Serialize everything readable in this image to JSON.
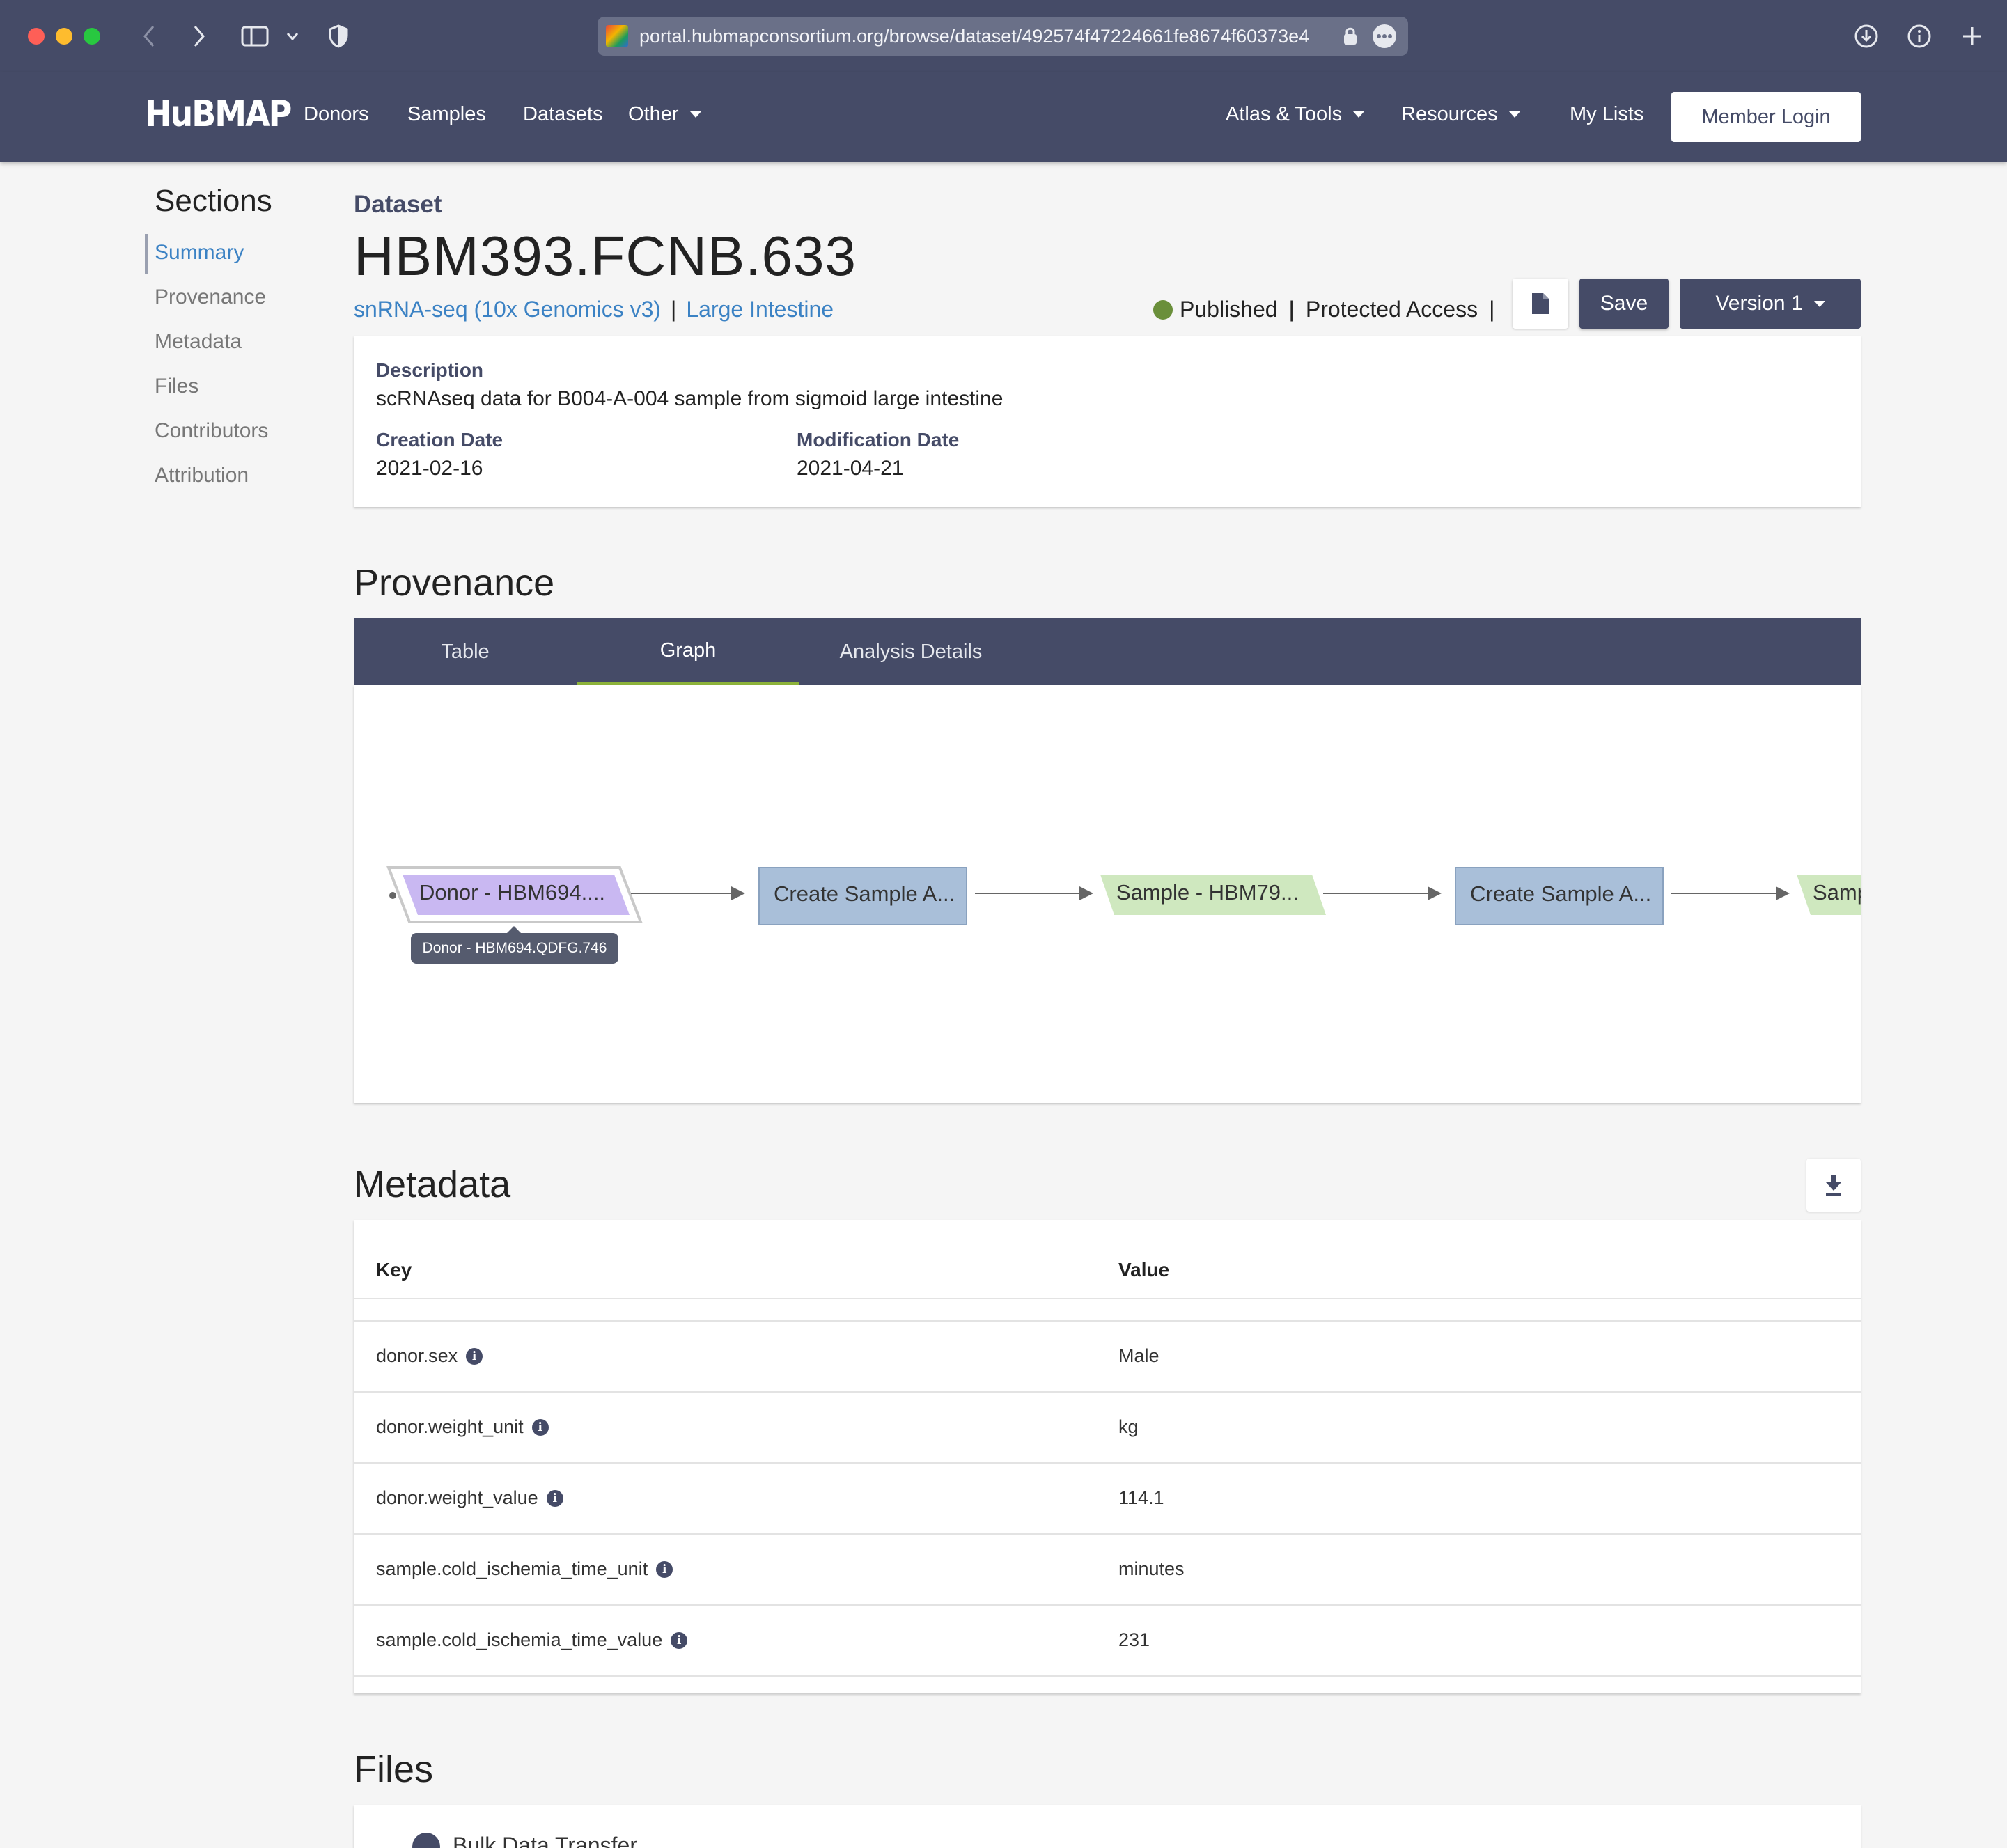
{
  "browser": {
    "url": "portal.hubmapconsortium.org/browse/dataset/492574f47224661fe8674f60373e4"
  },
  "navbar": {
    "logo": "HuBMAP",
    "links": {
      "donors": "Donors",
      "samples": "Samples",
      "datasets": "Datasets",
      "other": "Other",
      "atlas_tools": "Atlas & Tools",
      "resources": "Resources",
      "my_lists": "My Lists"
    },
    "login": "Member Login"
  },
  "sidebar": {
    "title": "Sections",
    "items": [
      "Summary",
      "Provenance",
      "Metadata",
      "Files",
      "Contributors",
      "Attribution"
    ]
  },
  "header": {
    "entity_type": "Dataset",
    "id": "HBM393.FCNB.633",
    "assay": "snRNA-seq (10x Genomics v3)",
    "organ": "Large Intestine",
    "status": "Published",
    "access": "Protected Access",
    "save": "Save",
    "version": "Version 1",
    "status_color": "#6a8f3a"
  },
  "summary": {
    "description_label": "Description",
    "description": "scRNAseq data for B004-A-004 sample from sigmoid large intestine",
    "creation_label": "Creation Date",
    "creation_date": "2021-02-16",
    "modification_label": "Modification Date",
    "modification_date": "2021-04-21"
  },
  "provenance": {
    "title": "Provenance",
    "tabs": [
      "Table",
      "Graph",
      "Analysis Details"
    ],
    "active_tab": "Graph",
    "nodes": [
      {
        "label": "Donor - HBM694....",
        "type": "donor"
      },
      {
        "label": "Create Sample A...",
        "type": "activity"
      },
      {
        "label": "Sample - HBM79...",
        "type": "sample"
      },
      {
        "label": "Create Sample A...",
        "type": "activity"
      },
      {
        "label": "Samp",
        "type": "sample"
      }
    ],
    "tooltip": "Donor - HBM694.QDFG.746",
    "colors": {
      "donor": "#c9b8f2",
      "activity": "#a9bfd9",
      "sample": "#cfe8bf"
    }
  },
  "metadata": {
    "title": "Metadata",
    "col_key": "Key",
    "col_value": "Value",
    "rows": [
      {
        "key": "donor.sex",
        "value": "Male"
      },
      {
        "key": "donor.weight_unit",
        "value": "kg"
      },
      {
        "key": "donor.weight_value",
        "value": "114.1"
      },
      {
        "key": "sample.cold_ischemia_time_unit",
        "value": "minutes"
      },
      {
        "key": "sample.cold_ischemia_time_value",
        "value": "231"
      }
    ]
  },
  "files": {
    "title": "Files",
    "bulk_transfer": "Bulk Data Transfer"
  }
}
